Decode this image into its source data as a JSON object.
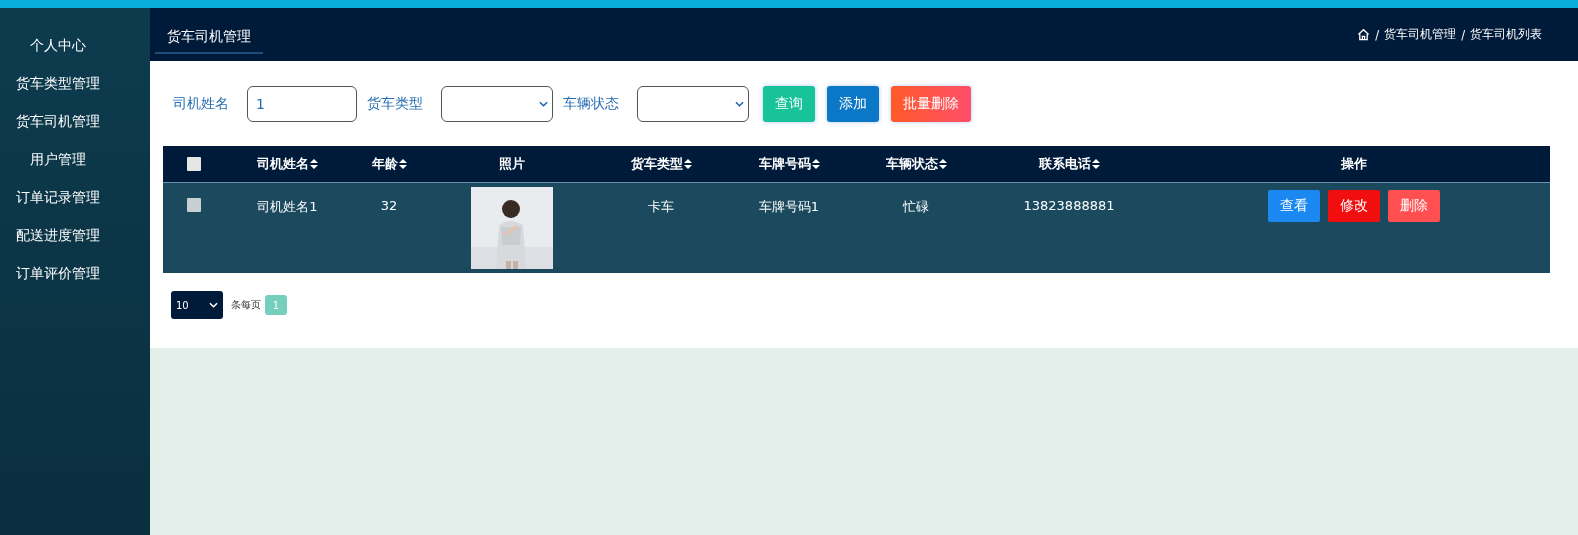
{
  "sidebar": {
    "items": [
      {
        "label": "个人中心"
      },
      {
        "label": "货车类型管理"
      },
      {
        "label": "货车司机管理"
      },
      {
        "label": "用户管理"
      },
      {
        "label": "订单记录管理"
      },
      {
        "label": "配送进度管理"
      },
      {
        "label": "订单评价管理"
      }
    ]
  },
  "header": {
    "tab": "货车司机管理",
    "breadcrumb": [
      {
        "separator": "/",
        "label": "货车司机管理"
      },
      {
        "separator": "/",
        "label": "货车司机列表"
      }
    ]
  },
  "filters": [
    {
      "kind": "input",
      "label": "司机姓名",
      "value": "1"
    },
    {
      "kind": "select",
      "label": "货车类型"
    },
    {
      "kind": "select",
      "label": "车辆状态"
    }
  ],
  "actions": [
    {
      "kind": "query",
      "label": "查询"
    },
    {
      "kind": "add",
      "label": "添加"
    },
    {
      "kind": "batch-delete",
      "label": "批量删除"
    }
  ],
  "table": {
    "columns": [
      {
        "kind": "checkbox",
        "checked": false
      },
      {
        "kind": "text",
        "label": "司机姓名",
        "sortable": true
      },
      {
        "kind": "text",
        "label": "年龄",
        "sortable": true
      },
      {
        "kind": "text",
        "label": "照片",
        "sortable": false
      },
      {
        "kind": "text",
        "label": "货车类型",
        "sortable": true
      },
      {
        "kind": "text",
        "label": "车牌号码",
        "sortable": true
      },
      {
        "kind": "text",
        "label": "车辆状态",
        "sortable": true
      },
      {
        "kind": "text",
        "label": "联系电话",
        "sortable": true
      },
      {
        "kind": "text",
        "label": "操作",
        "sortable": false
      }
    ],
    "rows": [
      {
        "cells": [
          {
            "kind": "checkbox",
            "checked": false
          },
          "司机姓名1",
          "32",
          {
            "kind": "picture"
          },
          "卡车",
          "车牌号码1",
          "忙碌",
          "13823888881",
          {
            "kind": "buttons",
            "buttons": [
              {
                "kind": "view",
                "label": "查看"
              },
              {
                "kind": "edit",
                "label": "修改"
              },
              {
                "kind": "delete",
                "label": "删除"
              }
            ]
          }
        ]
      }
    ]
  },
  "pagination": {
    "page_size": "10",
    "per_page_label": "条每页",
    "pages": [
      {
        "label": "1",
        "selected": true
      }
    ]
  }
}
